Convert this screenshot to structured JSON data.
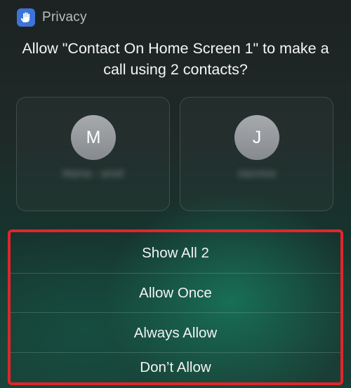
{
  "header": {
    "label": "Privacy",
    "icon": "hand-raised-icon",
    "icon_color": "#3e74d8"
  },
  "prompt": {
    "text": "Allow \"Contact On Home Screen 1\" to make a call using 2 contacts?"
  },
  "contacts": [
    {
      "initial": "M",
      "name": "Mama - amel"
    },
    {
      "initial": "J",
      "name": "Jasmine"
    }
  ],
  "actions": [
    {
      "label": "Show All 2"
    },
    {
      "label": "Allow Once"
    },
    {
      "label": "Always Allow"
    },
    {
      "label": "Don’t Allow"
    }
  ],
  "highlight_color": "#e0262b"
}
